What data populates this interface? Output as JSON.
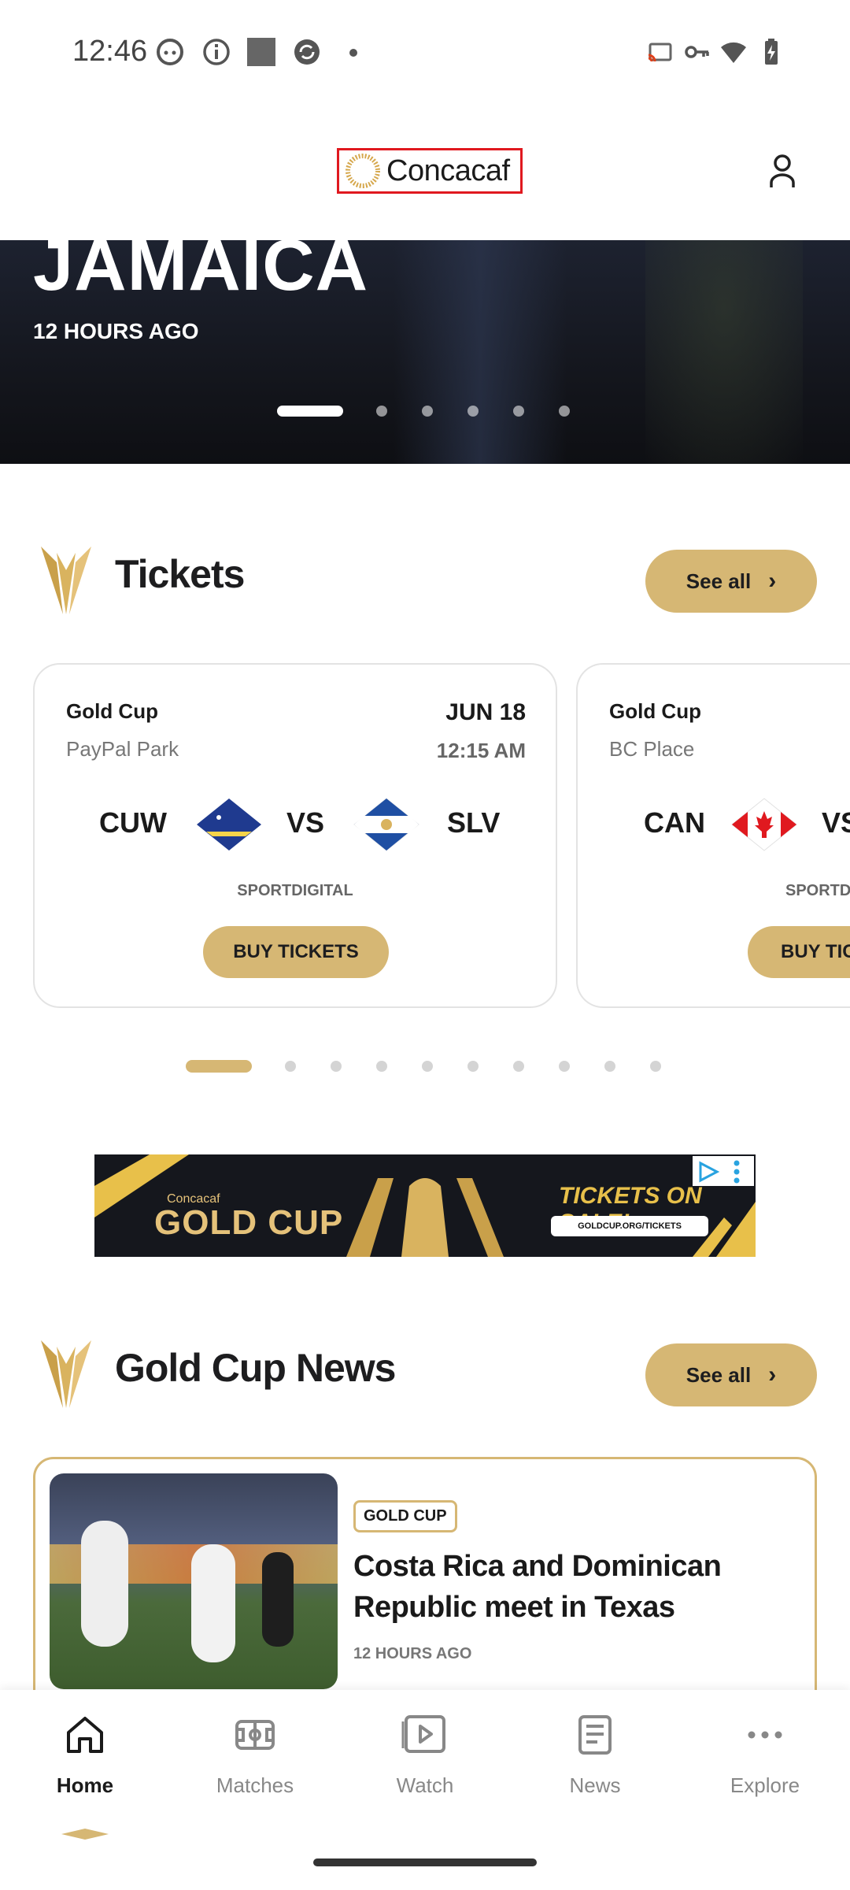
{
  "status_bar": {
    "time": "12:46",
    "icons": [
      "android-face-icon",
      "info-icon",
      "square-icon",
      "sync-icon",
      "dot-icon",
      "cast-icon",
      "vpn-key-icon",
      "wifi-icon",
      "battery-charging-icon"
    ]
  },
  "header": {
    "logo_text": "Concacaf",
    "account_icon": "person-icon"
  },
  "hero": {
    "title": "JAMAICA",
    "time_ago": "12 HOURS AGO",
    "page_count": 6,
    "active_page": 1
  },
  "tickets": {
    "title": "Tickets",
    "see_all": "See all",
    "cards": [
      {
        "competition": "Gold Cup",
        "venue": "PayPal Park",
        "date": "JUN 18",
        "time": "12:15 AM",
        "home": "CUW",
        "vs": "VS",
        "away": "SLV",
        "broadcaster": "SPORTDIGITAL",
        "buy_label": "BUY TICKETS"
      },
      {
        "competition": "Gold Cup",
        "venue": "BC Place",
        "home": "CAN",
        "vs": "VS",
        "broadcaster": "SPORTDI",
        "buy_label": "BUY TIC"
      }
    ],
    "page_count": 10,
    "active_page": 1
  },
  "ad": {
    "brand_small": "Concacaf",
    "brand": "GOLD CUP",
    "headline": "TICKETS ON SALE!",
    "url": "GOLDCUP.ORG/TICKETS"
  },
  "news": {
    "title": "Gold Cup News",
    "see_all": "See all",
    "article": {
      "tag": "GOLD CUP",
      "headline": "Costa Rica and Dominican Republic meet in Texas",
      "time_ago": "12 HOURS AGO"
    }
  },
  "bottom_nav": {
    "items": [
      {
        "label": "Home",
        "icon": "home-icon",
        "active": true
      },
      {
        "label": "Matches",
        "icon": "stadium-icon",
        "active": false
      },
      {
        "label": "Watch",
        "icon": "play-icon",
        "active": false
      },
      {
        "label": "News",
        "icon": "article-icon",
        "active": false
      },
      {
        "label": "Explore",
        "icon": "more-icon",
        "active": false
      }
    ]
  },
  "colors": {
    "accent": "#d6b774",
    "logo_border": "#e0191f",
    "text": "#1d1d1f"
  }
}
